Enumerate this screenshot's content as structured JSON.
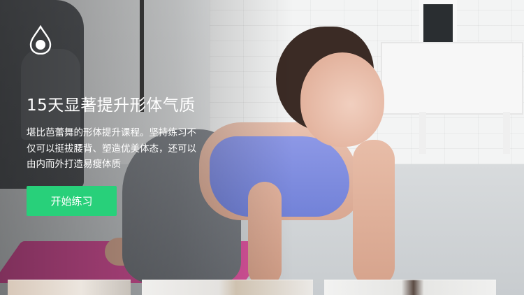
{
  "app": {
    "logo_icon": "water-drop-logo-icon"
  },
  "hero": {
    "title": "15天显著提升形体气质",
    "description_lines": [
      "堪比芭蕾舞的形体提升课程。坚持练习不",
      "仅可以挺拔腰背、塑造优美体态，还可以",
      "由内而外打造易瘦体质"
    ],
    "start_button_label": "开始练习",
    "accent_color": "#28d07a"
  },
  "thumbnails": [
    {
      "name": "course-thumbnail-1"
    },
    {
      "name": "course-thumbnail-2"
    },
    {
      "name": "course-thumbnail-3"
    }
  ]
}
